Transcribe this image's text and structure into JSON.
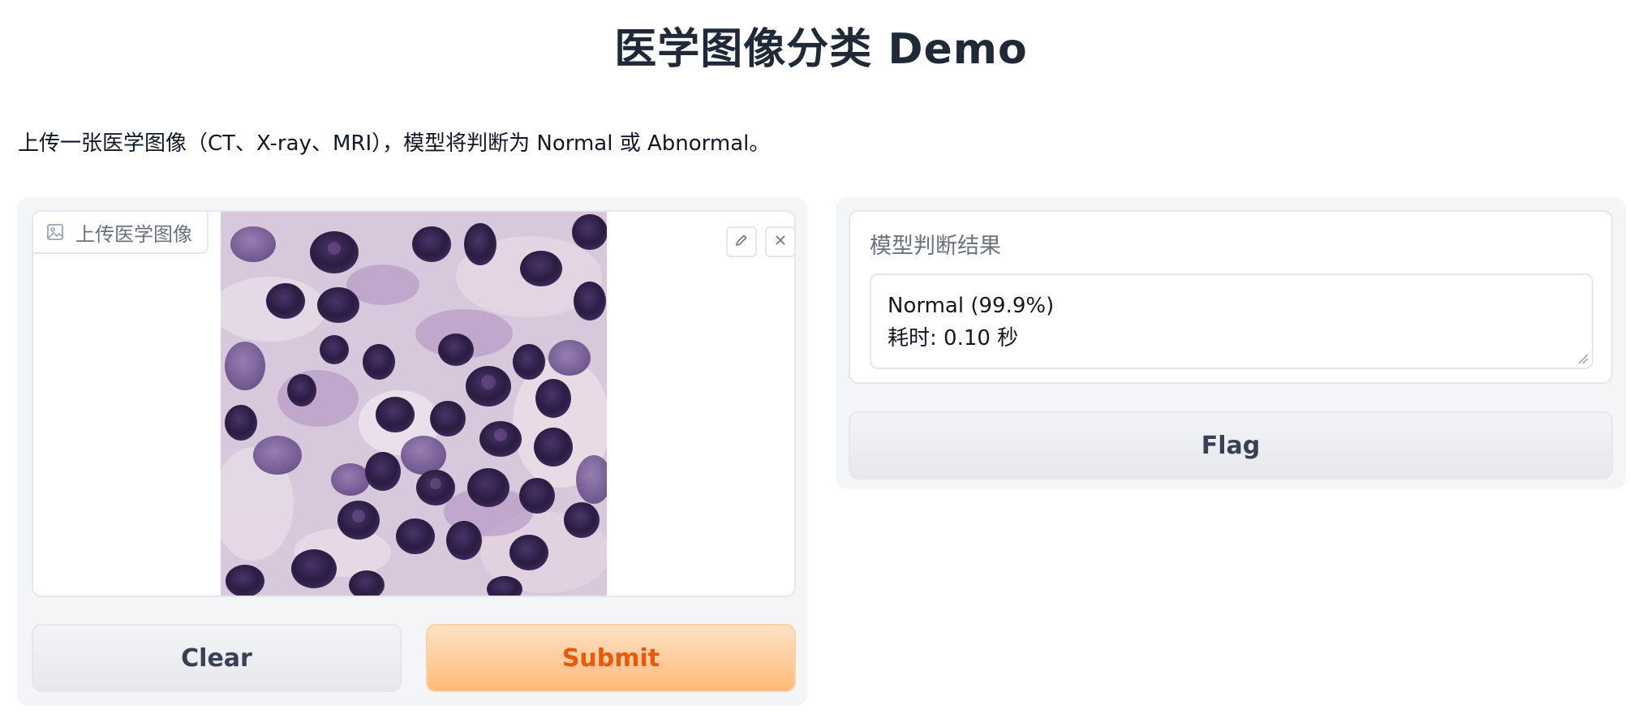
{
  "header": {
    "title": "医学图像分类 Demo",
    "description": "上传一张医学图像（CT、X-ray、MRI），模型将判断为 Normal 或 Abnormal。"
  },
  "input_panel": {
    "image_label": "上传医学图像",
    "image_label_icon": "image-icon",
    "edit_icon": "pencil-icon",
    "close_icon": "close-icon",
    "clear_label": "Clear",
    "submit_label": "Submit"
  },
  "output_panel": {
    "result_label": "模型判断结果",
    "result_lines": [
      "Normal (99.9%)",
      "耗时: 0.10 秒"
    ],
    "flag_label": "Flag"
  },
  "colors": {
    "submit_text": "#ea580c",
    "submit_bg": "#fdb97a",
    "panel_bg": "#f4f5f7"
  }
}
